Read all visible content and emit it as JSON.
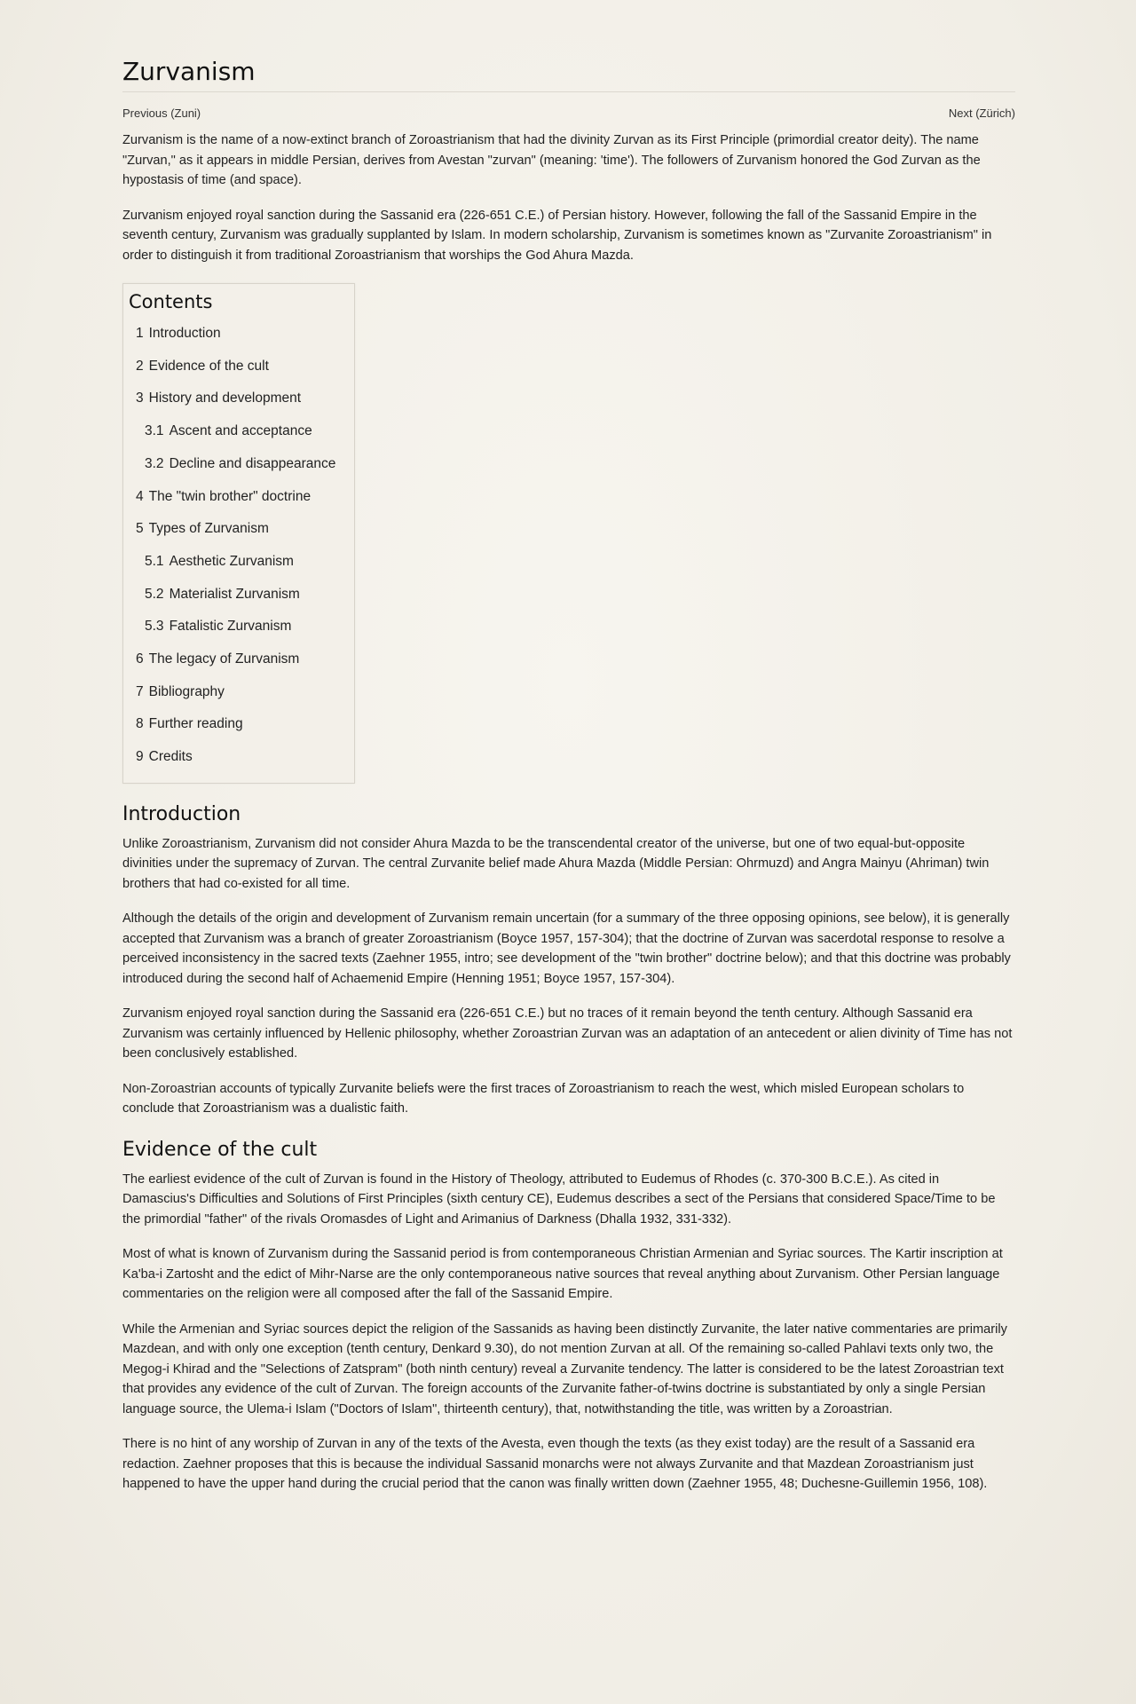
{
  "article": {
    "title": "Zurvanism",
    "previous_link": "Previous (Zuni)",
    "next_link": "Next (Zürich)",
    "intro_p1": "Zurvanism is the name of a now-extinct branch of Zoroastrianism that had the divinity Zurvan as its First Principle (primordial creator deity). The name \"Zurvan,\" as it appears in middle Persian, derives from Avestan \"zurvan\" (meaning: 'time'). The followers of Zurvanism honored the God Zurvan as the hypostasis of time (and space).",
    "intro_p2": "Zurvanism enjoyed royal sanction during the Sassanid era (226-651 C.E.) of Persian history. However, following the fall of the Sassanid Empire in the seventh century, Zurvanism was gradually supplanted by Islam. In modern scholarship, Zurvanism is sometimes known as \"Zurvanite Zoroastrianism\" in order to distinguish it from traditional Zoroastrianism that worships the God Ahura Mazda."
  },
  "toc": {
    "title": "Contents",
    "items": [
      {
        "num": "1",
        "label": "Introduction"
      },
      {
        "num": "2",
        "label": "Evidence of the cult"
      },
      {
        "num": "3",
        "label": "History and development"
      },
      {
        "num": "3.1",
        "label": "Ascent and acceptance"
      },
      {
        "num": "3.2",
        "label": "Decline and disappearance"
      },
      {
        "num": "4",
        "label": "The \"twin brother\" doctrine"
      },
      {
        "num": "5",
        "label": "Types of Zurvanism"
      },
      {
        "num": "5.1",
        "label": "Aesthetic Zurvanism"
      },
      {
        "num": "5.2",
        "label": "Materialist Zurvanism"
      },
      {
        "num": "5.3",
        "label": "Fatalistic Zurvanism"
      },
      {
        "num": "6",
        "label": "The legacy of Zurvanism"
      },
      {
        "num": "7",
        "label": "Bibliography"
      },
      {
        "num": "8",
        "label": "Further reading"
      },
      {
        "num": "9",
        "label": "Credits"
      }
    ]
  },
  "introduction": {
    "heading": "Introduction",
    "p1": "Unlike Zoroastrianism, Zurvanism did not consider Ahura Mazda to be the transcendental creator of the universe, but one of two equal-but-opposite divinities under the supremacy of Zurvan. The central Zurvanite belief made Ahura Mazda (Middle Persian: Ohrmuzd) and Angra Mainyu (Ahriman) twin brothers that had co-existed for all time.",
    "p2": "Although the details of the origin and development of Zurvanism remain uncertain (for a summary of the three opposing opinions, see below), it is generally accepted that Zurvanism was a branch of greater Zoroastrianism (Boyce 1957, 157-304); that the doctrine of Zurvan was sacerdotal response to resolve a perceived inconsistency in the sacred texts (Zaehner 1955, intro; see development of the \"twin brother\" doctrine below); and that this doctrine was probably introduced during the second half of Achaemenid Empire (Henning 1951; Boyce 1957, 157-304).",
    "p3": "Zurvanism enjoyed royal sanction during the Sassanid era (226-651 C.E.) but no traces of it remain beyond the tenth century. Although Sassanid era Zurvanism was certainly influenced by Hellenic philosophy, whether Zoroastrian Zurvan was an adaptation of an antecedent or alien divinity of Time has not been conclusively established.",
    "p4": "Non-Zoroastrian accounts of typically Zurvanite beliefs were the first traces of Zoroastrianism to reach the west, which misled European scholars to conclude that Zoroastrianism was a dualistic faith."
  },
  "evidence": {
    "heading": "Evidence of the cult",
    "p1": "The earliest evidence of the cult of Zurvan is found in the History of Theology, attributed to Eudemus of Rhodes (c. 370-300 B.C.E.). As cited in Damascius's Difficulties and Solutions of First Principles (sixth century CE), Eudemus describes a sect of the Persians that considered Space/Time to be the primordial \"father\" of the rivals Oromasdes of Light and Arimanius of Darkness (Dhalla 1932, 331-332).",
    "p2": "Most of what is known of Zurvanism during the Sassanid period is from contemporaneous Christian Armenian and Syriac sources. The Kartir inscription at Ka'ba-i Zartosht and the edict of Mihr-Narse are the only contemporaneous native sources that reveal anything about Zurvanism. Other Persian language commentaries on the religion were all composed after the fall of the Sassanid Empire.",
    "p3": "While the Armenian and Syriac sources depict the religion of the Sassanids as having been distinctly Zurvanite, the later native commentaries are primarily Mazdean, and with only one exception (tenth century, Denkard 9.30), do not mention Zurvan at all. Of the remaining so-called Pahlavi texts only two, the Megog-i Khirad and the \"Selections of Zatspram\" (both ninth century) reveal a Zurvanite tendency. The latter is considered to be the latest Zoroastrian text that provides any evidence of the cult of Zurvan. The foreign accounts of the Zurvanite father-of-twins doctrine is substantiated by only a single Persian language source, the Ulema-i Islam (\"Doctors of Islam\", thirteenth century), that, notwithstanding the title, was written by a Zoroastrian.",
    "p4": "There is no hint of any worship of Zurvan in any of the texts of the Avesta, even though the texts (as they exist today) are the result of a Sassanid era redaction. Zaehner proposes that this is because the individual Sassanid monarchs were not always Zurvanite and that Mazdean Zoroastrianism just happened to have the upper hand during the crucial period that the canon was finally written down (Zaehner 1955, 48; Duchesne-Guillemin 1956, 108)."
  }
}
